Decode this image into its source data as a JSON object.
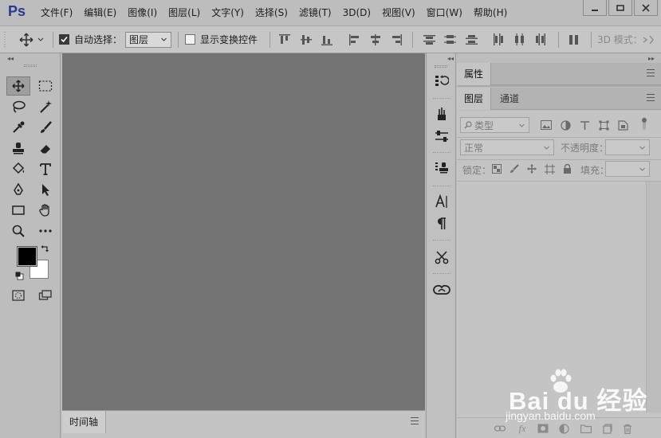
{
  "app": {
    "logo": "Ps"
  },
  "menu": [
    "文件(F)",
    "编辑(E)",
    "图像(I)",
    "图层(L)",
    "文字(Y)",
    "选择(S)",
    "滤镜(T)",
    "3D(D)",
    "视图(V)",
    "窗口(W)",
    "帮助(H)"
  ],
  "options": {
    "auto_select_label": "自动选择：",
    "auto_select_value": "图层",
    "show_transform_label": "显示变换控件",
    "mode_3d_label": "3D 模式："
  },
  "timeline": {
    "label": "时间轴"
  },
  "properties_panel": {
    "tab": "属性"
  },
  "layers_panel": {
    "tabs": [
      "图层",
      "通道"
    ],
    "filter_placeholder": "类型",
    "blend_mode": "正常",
    "opacity_label": "不透明度：",
    "lock_label": "锁定：",
    "fill_label": "填充："
  },
  "watermark": {
    "brand": "Bai du 经验",
    "url": "jingyan.baidu.com"
  },
  "colors": {
    "canvas": "#737373",
    "chrome": "#bdbdbd",
    "logo": "#2b3a8f"
  }
}
